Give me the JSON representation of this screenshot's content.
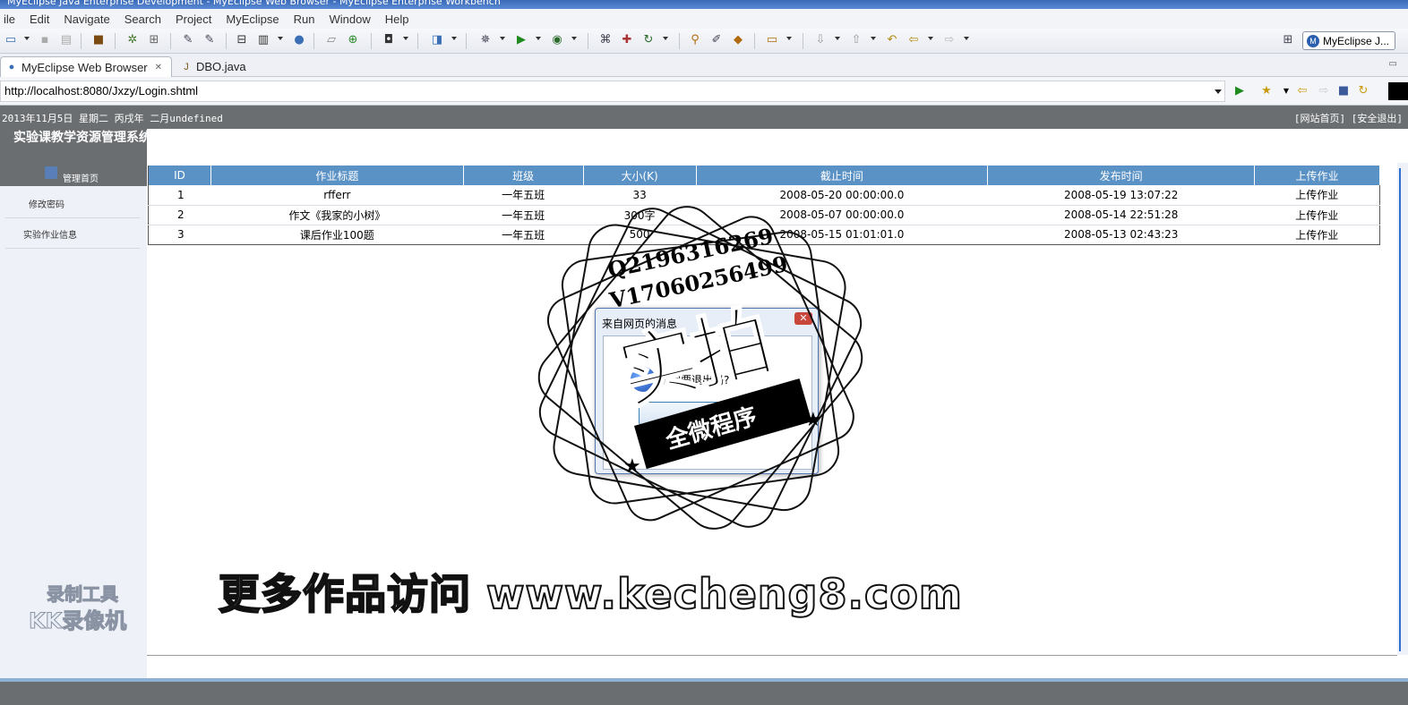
{
  "window": {
    "title": "MyEclipse Java Enterprise Development - MyEclipse Web Browser - MyEclipse Enterprise Workbench"
  },
  "menu": {
    "items": [
      "ile",
      "Edit",
      "Navigate",
      "Search",
      "Project",
      "MyEclipse",
      "Run",
      "Window",
      "Help"
    ]
  },
  "toolbar": {
    "perspective_label": "MyEclipse J...",
    "perspective_icon": "M"
  },
  "tabs": [
    {
      "label": "MyEclipse Web Browser",
      "close": "✕"
    },
    {
      "label": "DBO.java"
    }
  ],
  "address": {
    "url": "http://localhost:8080/Jxzy/Login.shtml"
  },
  "page": {
    "date_line": "2013年11月5日 星期二 丙戌年 二月undefined",
    "top_links": "[网站首页] [安全退出]",
    "system_title": "实验课教学资源管理系统",
    "manager_label": "管理首页",
    "nav": [
      "修改密码",
      "实验作业信息"
    ],
    "table": {
      "columns": [
        "ID",
        "作业标题",
        "班级",
        "大小(K)",
        "截止时间",
        "发布时间",
        "上传作业"
      ],
      "rows": [
        [
          "1",
          "rfferr",
          "一年五班",
          "33",
          "2008-05-20 00:00:00.0",
          "2008-05-19 13:07:22",
          "上传作业"
        ],
        [
          "2",
          "作文《我家的小树》",
          "一年五班",
          "300字",
          "2008-05-07 00:00:00.0",
          "2008-05-14 22:51:28",
          "上传作业"
        ],
        [
          "3",
          "课后作业100题",
          "一年五班",
          "500",
          "2008-05-15 01:01:01.0",
          "2008-05-13 02:43:23",
          "上传作业"
        ]
      ]
    }
  },
  "dialog": {
    "title": "来自网页的消息",
    "close": "✕",
    "message": "确定要退出吗?",
    "icon": "?"
  },
  "watermark": {
    "qq": "Q2196316269",
    "wechat": "V17060256499",
    "big": "实拍",
    "ribbon": "全微程序",
    "bottom": "更多作品访问 www.kecheng8.com",
    "left_line1": "录制工具",
    "left_line2": "KK录像机"
  },
  "colors": {
    "table_header": "#5b92c5",
    "page_header": "#6a6e71",
    "left_panel": "#eef1f7"
  }
}
